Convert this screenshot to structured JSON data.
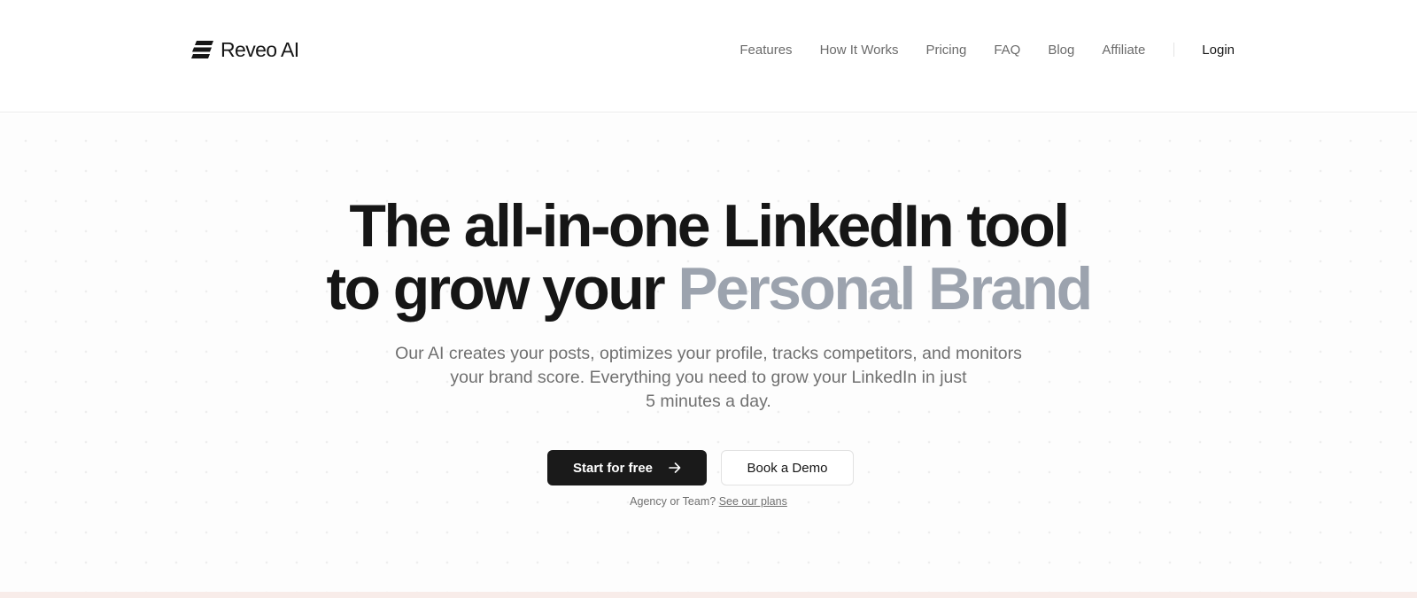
{
  "brand": {
    "name": "Reveo AI",
    "logo_icon": "stacked-bars-logo-icon"
  },
  "nav": {
    "links": [
      "Features",
      "How It Works",
      "Pricing",
      "FAQ",
      "Blog",
      "Affiliate"
    ],
    "login_label": "Login"
  },
  "hero": {
    "headline_line1": "The all-in-one LinkedIn tool",
    "headline_line2_prefix": "to grow your",
    "headline_line2_accent": "Personal Brand",
    "subtitle_lines": [
      "Our AI creates your posts, optimizes your profile, tracks competitors, and monitors",
      "your brand score. Everything you need to grow your LinkedIn in just",
      "5 minutes a day."
    ],
    "primary_cta": "Start for free",
    "primary_cta_icon": "arrow-right-icon",
    "secondary_cta": "Book a Demo",
    "plans_prefix": "Agency or Team?",
    "plans_link": "See our plans"
  },
  "colors": {
    "text": "#161616",
    "accent_gray": "#9ca3ae",
    "muted": "#707070",
    "button_dark": "#1a1a1a",
    "bottom_band": "#f8ece9"
  }
}
